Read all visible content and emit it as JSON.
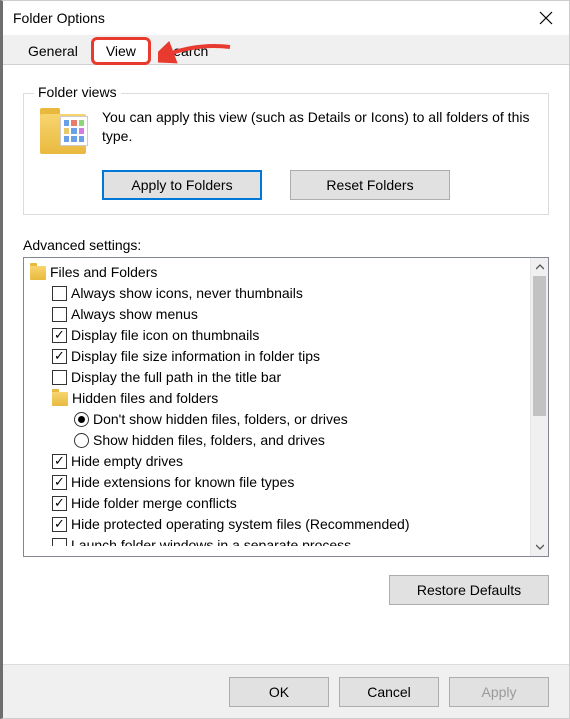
{
  "window": {
    "title": "Folder Options"
  },
  "tabs": {
    "general": "General",
    "view": "View",
    "search": "Search"
  },
  "folder_views": {
    "group_label": "Folder views",
    "description": "You can apply this view (such as Details or Icons) to all folders of this type.",
    "apply_btn": "Apply to Folders",
    "reset_btn": "Reset Folders"
  },
  "advanced": {
    "label": "Advanced settings:",
    "root": "Files and Folders",
    "items": [
      {
        "type": "check",
        "checked": false,
        "label": "Always show icons, never thumbnails"
      },
      {
        "type": "check",
        "checked": false,
        "label": "Always show menus"
      },
      {
        "type": "check",
        "checked": true,
        "label": "Display file icon on thumbnails"
      },
      {
        "type": "check",
        "checked": true,
        "label": "Display file size information in folder tips"
      },
      {
        "type": "check",
        "checked": false,
        "label": "Display the full path in the title bar"
      },
      {
        "type": "folder",
        "label": "Hidden files and folders"
      },
      {
        "type": "radio",
        "selected": true,
        "label": "Don't show hidden files, folders, or drives"
      },
      {
        "type": "radio",
        "selected": false,
        "label": "Show hidden files, folders, and drives"
      },
      {
        "type": "check",
        "checked": true,
        "label": "Hide empty drives"
      },
      {
        "type": "check",
        "checked": true,
        "label": "Hide extensions for known file types"
      },
      {
        "type": "check",
        "checked": true,
        "label": "Hide folder merge conflicts"
      },
      {
        "type": "check",
        "checked": true,
        "label": "Hide protected operating system files (Recommended)"
      },
      {
        "type": "check",
        "checked": false,
        "label": "Launch folder windows in a separate process"
      }
    ]
  },
  "buttons": {
    "restore_defaults": "Restore Defaults",
    "ok": "OK",
    "cancel": "Cancel",
    "apply": "Apply"
  }
}
